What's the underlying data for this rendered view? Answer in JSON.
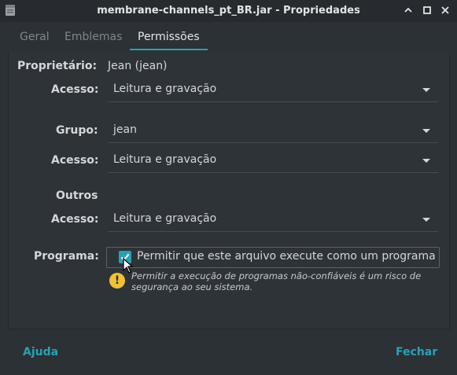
{
  "window": {
    "title": "membrane-channels_pt_BR.jar - Propriedades",
    "app_icon": "jar-file-icon",
    "buttons": [
      "minimize-icon",
      "maximize-icon",
      "close-icon"
    ]
  },
  "tabs": [
    {
      "label": "Geral",
      "active": false
    },
    {
      "label": "Emblemas",
      "active": false
    },
    {
      "label": "Permissões",
      "active": true
    }
  ],
  "permissions": {
    "owner_label": "Proprietário:",
    "owner_value": "Jean (jean)",
    "owner_access_label": "Acesso:",
    "owner_access_value": "Leitura e gravação",
    "group_label": "Grupo:",
    "group_value": "jean",
    "group_access_label": "Acesso:",
    "group_access_value": "Leitura e gravação",
    "others_label": "Outros",
    "others_access_label": "Acesso:",
    "others_access_value": "Leitura e gravação",
    "program_label": "Programa:",
    "program_checkbox_label": "Permitir que este arquivo execute como um programa",
    "program_checked": true,
    "warning_text": "Permitir a execução de programas não-confiáveis é um risco de segurança ao seu sistema."
  },
  "footer": {
    "help_label": "Ajuda",
    "close_label": "Fechar"
  },
  "colors": {
    "accent": "#2aa1b3",
    "background": "#2c3136",
    "warning": "#f2c037"
  }
}
